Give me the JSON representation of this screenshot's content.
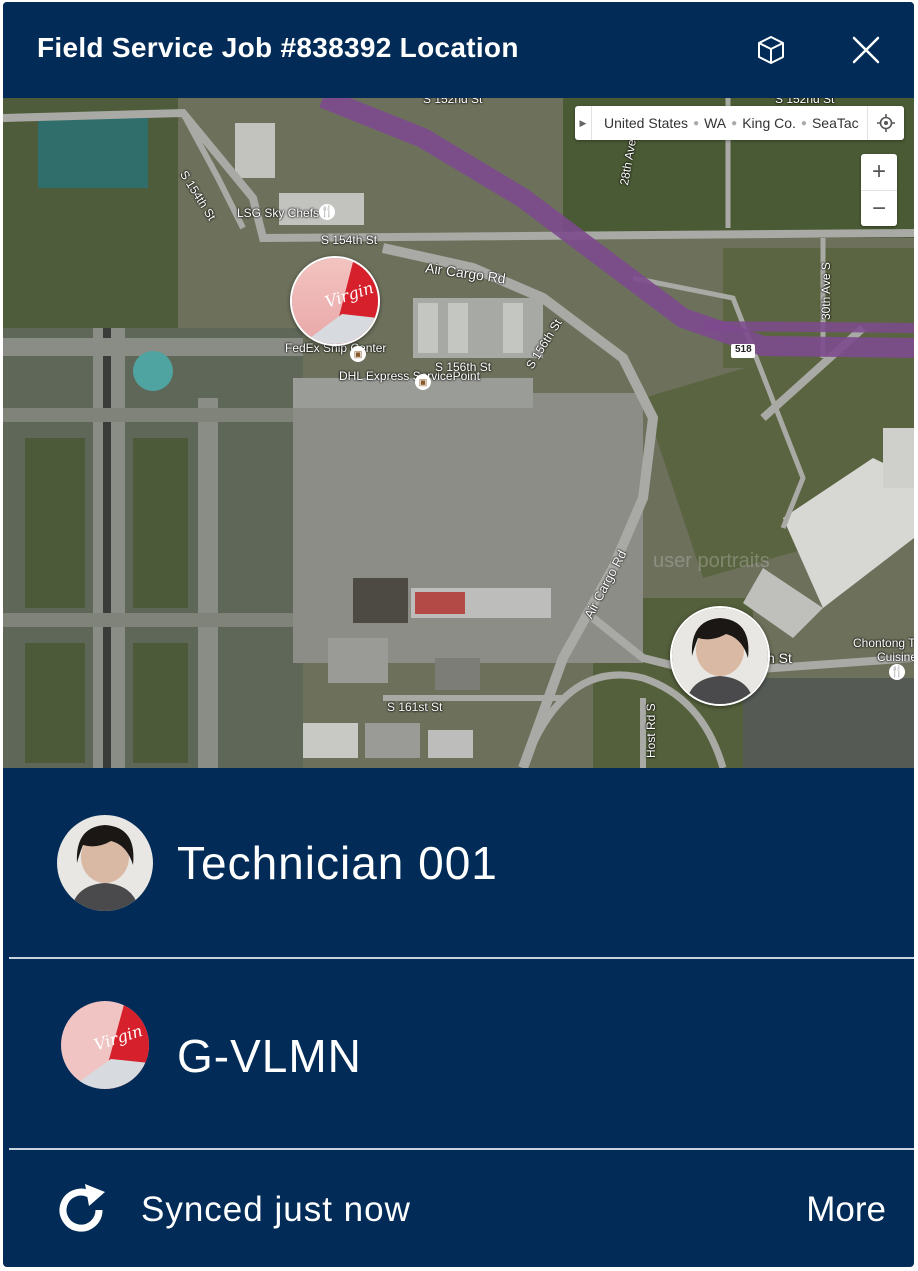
{
  "header": {
    "title": "Field Service Job #838392 Location",
    "icons": [
      "cube-icon",
      "close-icon"
    ]
  },
  "map": {
    "breadcrumb": [
      "United States",
      "WA",
      "King Co.",
      "SeaTac"
    ],
    "zoom_in_label": "+",
    "zoom_out_label": "−",
    "labels": {
      "s152nd_a": "S 152nd St",
      "s152nd_b": "S 152nd St",
      "s154th_diag": "S 154th St",
      "s154th": "S 154th St",
      "lsg": "LSG Sky Chefs",
      "air_cargo_rd": "Air Cargo Rd",
      "air_cargo_rd_diag": "Air Cargo Rd",
      "fedex": "FedEx Ship Center",
      "dhl": "DHL Express ServicePoint",
      "s156th": "S 156th St",
      "s156th_diag": "S 156th St",
      "ave28th": "28th Ave S",
      "ave30th": "30th Ave S",
      "route518": "518",
      "s161st": "S 161st St",
      "host_rd": "Host Rd S",
      "h_st": "h St",
      "chontong": "Chontong T",
      "cuisine": "Cuisine",
      "watermark": "user portraits"
    },
    "pins": [
      "aircraft-pin",
      "technician-pin"
    ]
  },
  "resources": [
    {
      "name": "Technician 001",
      "avatar": "technician-avatar"
    },
    {
      "name": "G-VLMN",
      "avatar": "aircraft-avatar"
    }
  ],
  "footer": {
    "status": "Synced just now",
    "more_label": "More"
  },
  "colors": {
    "panel": "#022c57",
    "text": "#ffffff",
    "highway": "#7c4a8e"
  }
}
